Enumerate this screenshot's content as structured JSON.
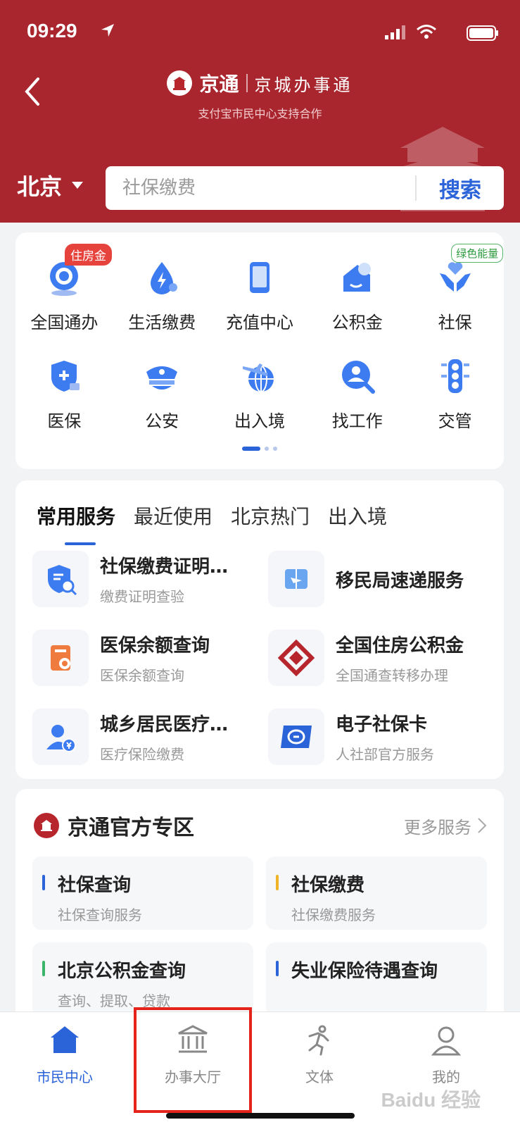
{
  "status": {
    "time": "09:29"
  },
  "header": {
    "logo_name": "京通",
    "logo_sub": "京城办事通",
    "logo_caption": "支付宝市民中心支持合作",
    "city": "北京",
    "search_placeholder": "社保缴费",
    "search_button": "搜索"
  },
  "grid": {
    "items": [
      {
        "label": "全国通办",
        "icon": "globe-service-icon",
        "badge": "住房金"
      },
      {
        "label": "生活缴费",
        "icon": "water-bolt-icon"
      },
      {
        "label": "充值中心",
        "icon": "phone-icon"
      },
      {
        "label": "公积金",
        "icon": "house-fund-icon"
      },
      {
        "label": "社保",
        "icon": "hands-heart-icon",
        "badge": "绿色能量"
      },
      {
        "label": "医保",
        "icon": "medical-shield-icon"
      },
      {
        "label": "公安",
        "icon": "police-cap-icon"
      },
      {
        "label": "出入境",
        "icon": "plane-globe-icon"
      },
      {
        "label": "找工作",
        "icon": "job-search-icon"
      },
      {
        "label": "交管",
        "icon": "traffic-light-icon"
      }
    ]
  },
  "services": {
    "tabs": [
      "常用服务",
      "最近使用",
      "北京热门",
      "出入境"
    ],
    "items": [
      {
        "title": "社保缴费证明…",
        "sub": "缴费证明查验"
      },
      {
        "title": "移民局速递服务",
        "sub": ""
      },
      {
        "title": "医保余额查询",
        "sub": "医保余额查询"
      },
      {
        "title": "全国住房公积金",
        "sub": "全国通查转移办理"
      },
      {
        "title": "城乡居民医疗…",
        "sub": "医疗保险缴费"
      },
      {
        "title": "电子社保卡",
        "sub": "人社部官方服务"
      }
    ]
  },
  "official": {
    "title": "京通官方专区",
    "more": "更多服务",
    "items": [
      {
        "name": "社保查询",
        "desc": "社保查询服务",
        "color": "#2b63d9"
      },
      {
        "name": "社保缴费",
        "desc": "社保缴费服务",
        "color": "#f0b429"
      },
      {
        "name": "北京公积金查询",
        "desc": "查询、提取、贷款",
        "color": "#3bb56a"
      },
      {
        "name": "失业保险待遇查询",
        "desc": "",
        "color": "#2b63d9"
      }
    ]
  },
  "tabbar": {
    "items": [
      {
        "label": "市民中心",
        "active": true
      },
      {
        "label": "办事大厅"
      },
      {
        "label": "文体"
      },
      {
        "label": "我的"
      }
    ]
  },
  "watermark": "Baidu 经验",
  "colors": {
    "brand_red": "#a9262e",
    "accent_blue": "#2b63d9",
    "highlight_red": "#e4241b"
  }
}
